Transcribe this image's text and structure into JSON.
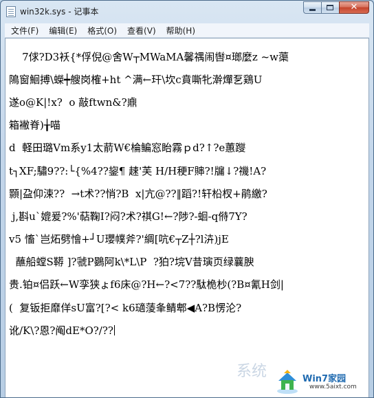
{
  "window": {
    "title": "win32k.sys - 记事本",
    "close_glyph": "✕"
  },
  "menu": {
    "items": [
      "文件(F)",
      "编辑(E)",
      "格式(O)",
      "查看(V)",
      "帮助(H)"
    ]
  },
  "editor": {
    "lines": [
      "    7俅?D3袄{*俘倪@舍W┬MWaMA馨禑闹辔¤瑯麼z ~w蕖",
      "隝窗鮰搏\\蠑┿艘岗榷+ht ^满←玕\\坎c賁嘶牝澣燀乭鶏U",
      "遂o@K|!x?  o 敲ftwn&?鼑",
      "箱襒脊)╁喵",
      "d  軽田璐Vm系y1太葥W€棆鳊窓眙霧ｐd?↑?e蕙躞",
      "t┐XF;驌9??:└{%4??鋆¶ 趚'芙 H/H稉F賗?!牖↓?禨!A?",
      "顥|盁仰涑??  →t术??悄?B  x|亢@??‖蹈?!轩柗杈+鹃繳?",
      " j,斟u`媲爰?%'萜鞠I?闷?术?祺G!←?陟?-蛔-q偫7Y?",
      "v5 慉`岂炻劈懀+┘U瓔幞斧?'綢[吭€┬Z┼?l泋)jE",
      "  蘸船螳S鞯 ]?虢P鷃阿k\\*L\\P  ?狛?垸V昔璌页绿蘘腴",
      "贵.铂¤侣跃←W孪狭ょf6床@?H←?<7??駄桅杪(?B¤氰H剑|",
      "(  复钣拒靡佯sU富?[?< k6瓋蔆夆鲭郫◀A?B愣沦?",
      "讹/K\\?恩?阄dE*O?/??"
    ]
  },
  "watermark": {
    "title": "Win7家园",
    "url": "www.5aixt.com",
    "faint_text": "系统"
  }
}
